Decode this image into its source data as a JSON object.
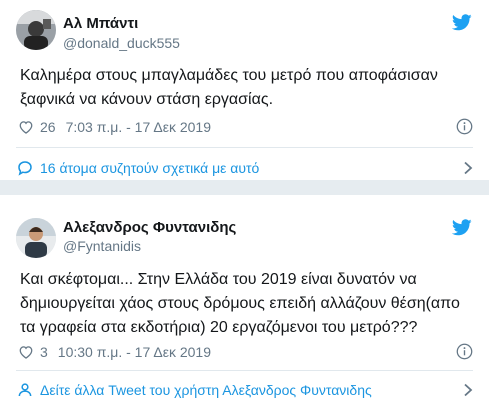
{
  "colors": {
    "accent": "#1da1f2",
    "link": "#1b95e0",
    "muted": "#657786",
    "divider": "#e6ecf0"
  },
  "tweets": [
    {
      "display_name": "Αλ Μπάντι",
      "handle": "@donald_duck555",
      "text": "Καλημέρα στους μπαγλαμάδες του μετρό που αποφάσισαν ξαφνικά να κάνουν στάση εργασίας.",
      "likes": "26",
      "timestamp": "7:03 π.μ. - 17 Δεκ 2019",
      "footer_text": "16 άτομα συζητούν σχετικά με αυτό",
      "footer_icon": "comment-icon"
    },
    {
      "display_name": "Αλεξανδρος Φυντανιδης",
      "handle": "@Fyntanidis",
      "text": "Και σκέφτομαι... Στην Ελλάδα του 2019 είναι δυνατόν να δημιουργείται χάος στους δρόμους επειδή αλλάζουν θέση(απο τα γραφεία στα εκδοτήρια) 20 εργαζόμενοι του μετρό???",
      "likes": "3",
      "timestamp": "10:30 π.μ. - 17 Δεκ 2019",
      "footer_text": "Δείτε άλλα Tweet του χρήστη Αλεξανδρος Φυντανιδης",
      "footer_icon": "person-icon"
    }
  ]
}
